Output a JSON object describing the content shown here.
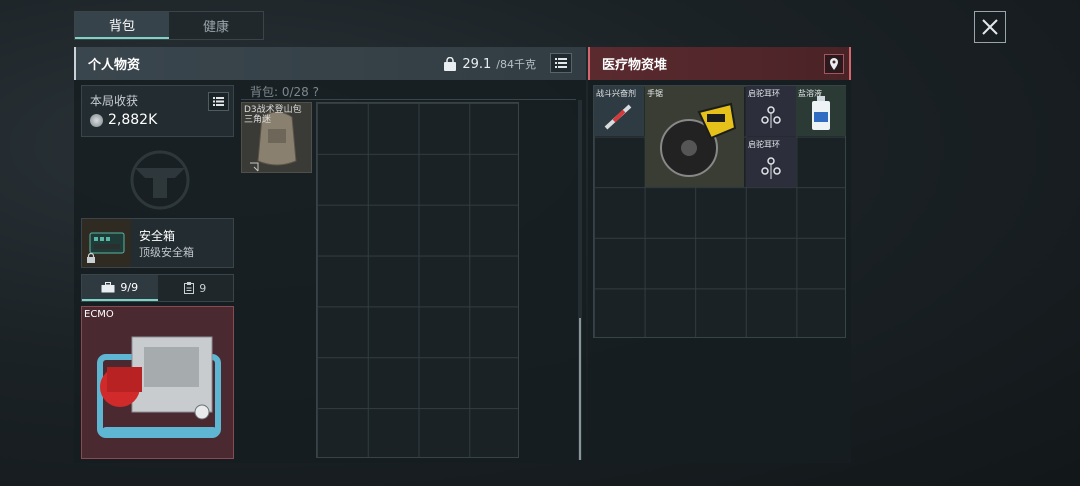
{
  "tabs": [
    {
      "label": "背包",
      "active": true
    },
    {
      "label": "健康",
      "active": false
    }
  ],
  "left_panel": {
    "title": "个人物资",
    "weight_current": "29.1",
    "weight_max": "/84千克"
  },
  "income": {
    "label": "本局收获",
    "value": "2,882K"
  },
  "safe_box": {
    "name": "安全箱",
    "subtitle": "顶级安全箱"
  },
  "subtabs": [
    {
      "label": "9/9",
      "icon": "briefcase-icon",
      "active": true
    },
    {
      "label": "9",
      "icon": "clipboard-icon",
      "active": false
    }
  ],
  "ecmo": {
    "label": "ECMO"
  },
  "backpack": {
    "header": "背包: 0/28  ?",
    "item_label": "D3战术登山包 三角迷"
  },
  "med_panel": {
    "title": "医疗物资堆",
    "items": [
      {
        "label": "战斗兴奋剂",
        "icon": "syringe-icon"
      },
      {
        "label": "手锯",
        "icon": "circular-saw-icon"
      },
      {
        "label": "启驼耳环",
        "icon": "earring-icon"
      },
      {
        "label": "盐溶液",
        "icon": "saline-bottle-icon"
      },
      {
        "label": "启驼耳环",
        "icon": "earring-icon"
      }
    ]
  },
  "colors": {
    "accent": "#7fd3c4",
    "medical_red": "#d4666f",
    "ecmo_bg": "#4a2a30"
  }
}
